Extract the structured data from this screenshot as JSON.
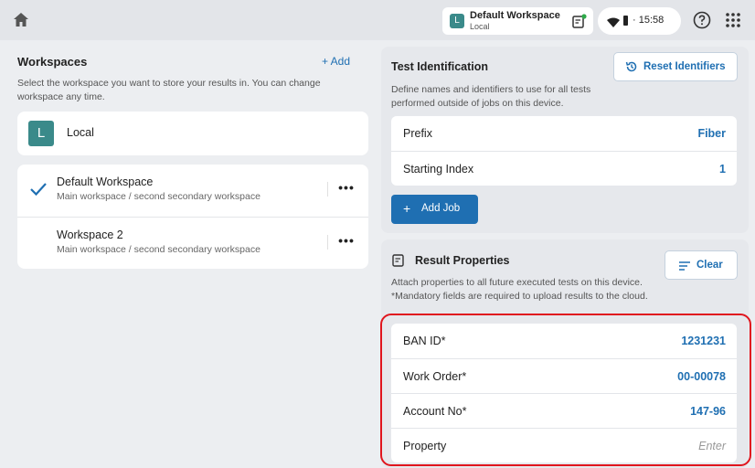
{
  "topbar": {
    "workspace_avatar": "L",
    "workspace_name": "Default Workspace",
    "workspace_sub": "Local",
    "time": "15:58",
    "icons": [
      "home-icon",
      "clipboard-icon",
      "wifi-icon",
      "battery-icon",
      "help-icon",
      "apps-grid-icon"
    ]
  },
  "workspaces": {
    "title": "Workspaces",
    "add_label": "+ Add",
    "description": "Select the workspace you want to store your results in. You can change workspace any time.",
    "local": {
      "avatar": "L",
      "label": "Local"
    },
    "items": [
      {
        "name": "Default Workspace",
        "sub": "Main workspace / second secondary workspace",
        "selected": true,
        "more": "•••"
      },
      {
        "name": "Workspace 2",
        "sub": "Main workspace / second secondary workspace",
        "selected": false,
        "more": "•••"
      }
    ]
  },
  "test_identification": {
    "title": "Test Identification",
    "reset_label": "Reset Identifiers",
    "description": "Define names and identifiers to use for all tests performed outside of jobs on this device.",
    "rows": [
      {
        "key": "Prefix",
        "value": "Fiber"
      },
      {
        "key": "Starting Index",
        "value": "1"
      }
    ],
    "add_job_label": "Add Job"
  },
  "result_properties": {
    "title": "Result Properties",
    "clear_label": "Clear",
    "description": "Attach properties to all future executed tests on this device. *Mandatory fields are required to upload results to the cloud.",
    "rows": [
      {
        "key": "BAN ID*",
        "value": "1231231"
      },
      {
        "key": "Work Order*",
        "value": "00-00078"
      },
      {
        "key": "Account No*",
        "value": "147-96"
      },
      {
        "key": "Property",
        "placeholder": "Enter"
      }
    ]
  },
  "colors": {
    "accent": "#1f6fb2",
    "avatar": "#3a8a8a",
    "highlight": "#e0161e"
  }
}
